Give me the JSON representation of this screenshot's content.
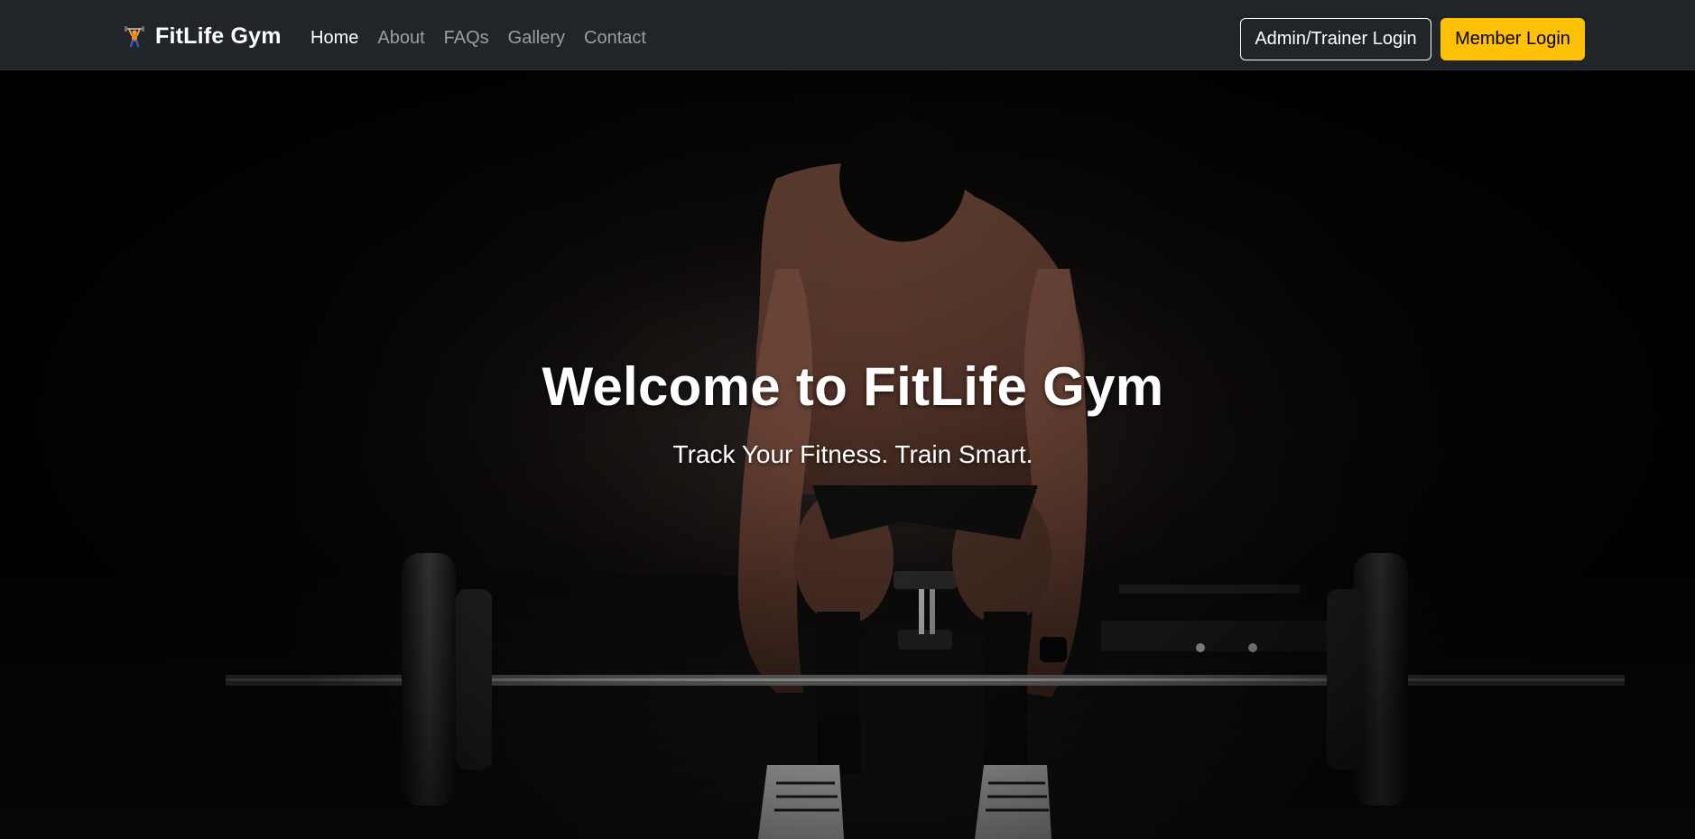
{
  "navbar": {
    "brand": {
      "icon": "weightlifter-icon",
      "name": "FitLife Gym"
    },
    "links": [
      {
        "label": "Home",
        "active": true
      },
      {
        "label": "About",
        "active": false
      },
      {
        "label": "FAQs",
        "active": false
      },
      {
        "label": "Gallery",
        "active": false
      },
      {
        "label": "Contact",
        "active": false
      }
    ],
    "admin_login_label": "Admin/Trainer Login",
    "member_login_label": "Member Login"
  },
  "hero": {
    "title": "Welcome to FitLife Gym",
    "subtitle": "Track Your Fitness. Train Smart.",
    "background": "man-deadlifting-barbell-dark-gym-photo"
  },
  "colors": {
    "navbar_bg": "#212529",
    "accent": "#ffc107",
    "nav_inactive": "rgba(255,255,255,0.55)",
    "nav_active": "#ffffff"
  }
}
